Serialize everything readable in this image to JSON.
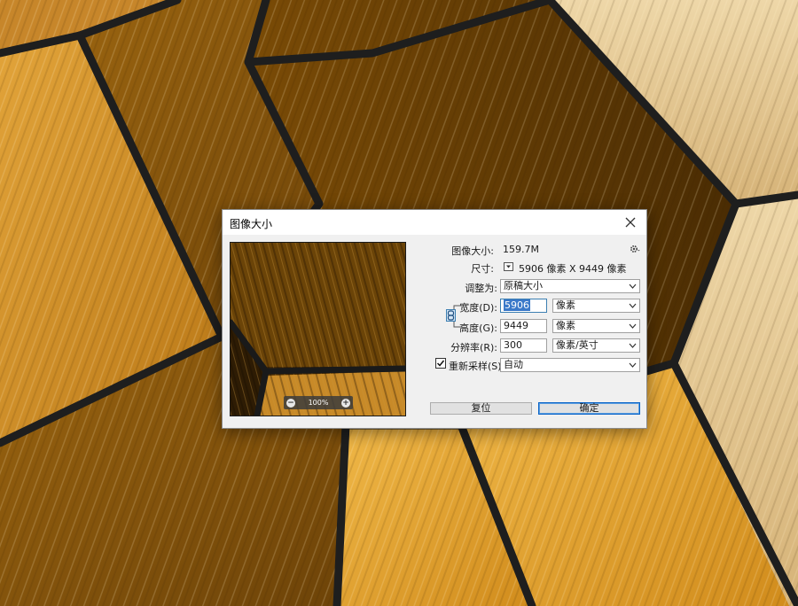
{
  "dialog": {
    "title": "图像大小",
    "image_size_label": "图像大小:",
    "image_size_value": "159.7M",
    "dimensions_label": "尺寸:",
    "dimensions_value": "5906 像素  X  9449 像素",
    "fit_to_label": "调整为:",
    "fit_to_value": "原稿大小",
    "width_label": "宽度(D):",
    "width_value": "5906",
    "width_unit": "像素",
    "height_label": "高度(G):",
    "height_value": "9449",
    "height_unit": "像素",
    "resolution_label": "分辨率(R):",
    "resolution_value": "300",
    "resolution_unit": "像素/英寸",
    "resample_label": "重新采样(S):",
    "resample_checked": true,
    "resample_value": "自动",
    "zoom_level": "100%",
    "reset_button": "复位",
    "ok_button": "确定"
  },
  "colors": {
    "background_amber": "#c8871f",
    "lead_line": "#1e1e1e",
    "dialog_bg": "#f0f0f0",
    "accent_blue": "#0a64c8"
  }
}
